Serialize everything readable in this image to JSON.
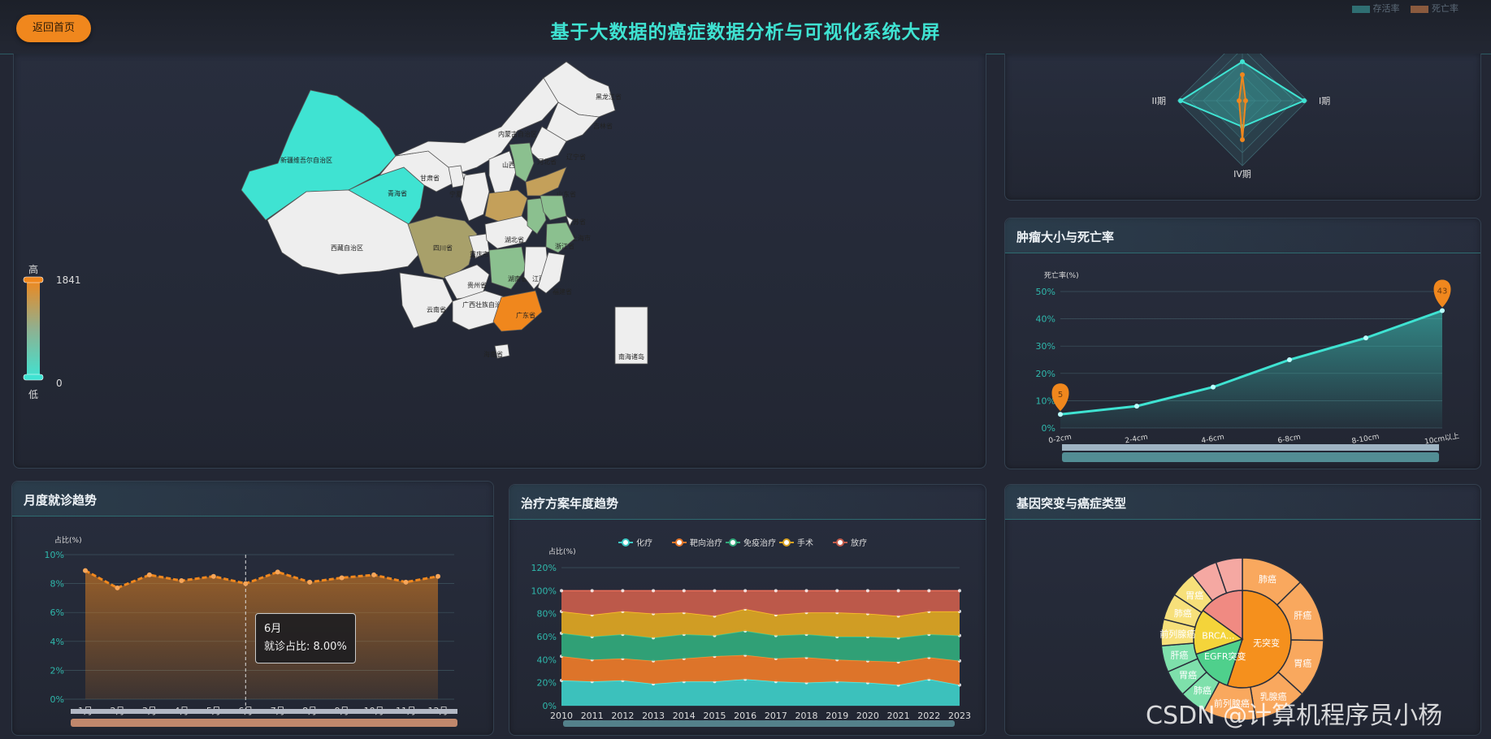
{
  "header": {
    "title": "基于大数据的癌症数据分析与可视化系统大屏",
    "back_label": "返回首页",
    "top_legend": [
      "存活率",
      "死亡率"
    ],
    "colors": {
      "accent": "#3fe3d2",
      "orange": "#f0871d"
    }
  },
  "map": {
    "visual_map": {
      "high_label": "高",
      "low_label": "低",
      "max": "1841",
      "min": "0"
    },
    "regions": [
      {
        "name": "新疆维吾尔自治区",
        "level": "high",
        "color": "#3fe3d2"
      },
      {
        "name": "青海省",
        "level": "high",
        "color": "#3fe3d2"
      },
      {
        "name": "西藏自治区",
        "level": "none",
        "color": "#eeeeee"
      },
      {
        "name": "甘肃省",
        "level": "none",
        "color": "#eeeeee"
      },
      {
        "name": "内蒙古自治区",
        "level": "none",
        "color": "#eeeeee"
      },
      {
        "name": "黑龙江省",
        "level": "none",
        "color": "#eeeeee"
      },
      {
        "name": "吉林省",
        "level": "none",
        "color": "#eeeeee"
      },
      {
        "name": "辽宁省",
        "level": "none",
        "color": "#eeeeee"
      },
      {
        "name": "宁夏回族自治区",
        "level": "none",
        "color": "#eeeeee"
      },
      {
        "name": "陕西省",
        "level": "none",
        "color": "#eeeeee"
      },
      {
        "name": "山西省",
        "level": "none",
        "color": "#eeeeee"
      },
      {
        "name": "河北省",
        "level": "mid",
        "color": "#8bc08f"
      },
      {
        "name": "山东省",
        "level": "mid",
        "color": "#c4a05a"
      },
      {
        "name": "河南省",
        "level": "mid",
        "color": "#c4a05a"
      },
      {
        "name": "四川省",
        "level": "mid",
        "color": "#a8a06a"
      },
      {
        "name": "重庆市",
        "level": "none",
        "color": "#eeeeee"
      },
      {
        "name": "湖北省",
        "level": "none",
        "color": "#eeeeee"
      },
      {
        "name": "安徽省",
        "level": "mid",
        "color": "#8bc08f"
      },
      {
        "name": "江苏省",
        "level": "mid",
        "color": "#8bc08f"
      },
      {
        "name": "上海市",
        "level": "none",
        "color": "#eeeeee"
      },
      {
        "name": "浙江省",
        "level": "mid",
        "color": "#8bc08f"
      },
      {
        "name": "湖南省",
        "level": "mid",
        "color": "#8bc08f"
      },
      {
        "name": "江西省",
        "level": "none",
        "color": "#eeeeee"
      },
      {
        "name": "福建省",
        "level": "none",
        "color": "#eeeeee"
      },
      {
        "name": "贵州省",
        "level": "none",
        "color": "#eeeeee"
      },
      {
        "name": "云南省",
        "level": "none",
        "color": "#eeeeee"
      },
      {
        "name": "广西壮族自治区",
        "level": "none",
        "color": "#eeeeee"
      },
      {
        "name": "广东省",
        "level": "max",
        "color": "#f0871d"
      },
      {
        "name": "海南省",
        "level": "none",
        "color": "#eeeeee"
      },
      {
        "name": "南海诸岛",
        "level": "none",
        "color": "#eeeeee"
      }
    ]
  },
  "radar": {
    "axes": [
      "III期",
      "I期",
      "IV期",
      "II期"
    ]
  },
  "tumor_panel": {
    "title": "肿瘤大小与死亡率"
  },
  "monthly_panel": {
    "title": "月度就诊趋势"
  },
  "treatment_panel": {
    "title": "治疗方案年度趋势"
  },
  "gene_panel": {
    "title": "基因突变与癌症类型"
  },
  "tooltip": {
    "title": "6月",
    "line": "就诊占比: 8.00%"
  },
  "watermark": "CSDN @计算机程序员小杨",
  "chart_data": [
    {
      "id": "tumor",
      "type": "line",
      "title": "肿瘤大小与死亡率",
      "ylabel": "死亡率(%)",
      "categories": [
        "0-2cm",
        "2-4cm",
        "4-6cm",
        "6-8cm",
        "8-10cm",
        "10cm以上"
      ],
      "values": [
        5,
        8,
        15,
        25,
        33,
        43
      ],
      "x_positions": [
        0,
        1,
        2,
        3,
        4,
        5
      ],
      "ylim": [
        0,
        50
      ],
      "yticks": [
        "0%",
        "10%",
        "20%",
        "30%",
        "40%",
        "50%"
      ],
      "markers": [
        {
          "label": "5",
          "index": 0
        },
        {
          "label": "43",
          "index": 5
        }
      ],
      "color": "#3fe3d2"
    },
    {
      "id": "monthly",
      "type": "area",
      "title": "月度就诊趋势",
      "ylabel": "占比(%)",
      "categories": [
        "1月",
        "2月",
        "3月",
        "4月",
        "5月",
        "6月",
        "7月",
        "8月",
        "9月",
        "10月",
        "11月",
        "12月"
      ],
      "values": [
        8.9,
        7.7,
        8.6,
        8.2,
        8.5,
        8.0,
        8.8,
        8.1,
        8.4,
        8.6,
        8.1,
        8.5
      ],
      "ylim": [
        0,
        10
      ],
      "yticks": [
        "0%",
        "2%",
        "4%",
        "6%",
        "8%",
        "10%"
      ],
      "highlight_index": 5,
      "color": "#f0871d"
    },
    {
      "id": "treatment",
      "type": "area",
      "title": "治疗方案年度趋势",
      "ylabel": "占比(%)",
      "categories": [
        "2010",
        "2011",
        "2012",
        "2013",
        "2014",
        "2015",
        "2016",
        "2017",
        "2018",
        "2019",
        "2020",
        "2021",
        "2022",
        "2023"
      ],
      "ylim": [
        0,
        120
      ],
      "yticks": [
        "0%",
        "20%",
        "40%",
        "60%",
        "80%",
        "100%",
        "120%"
      ],
      "legend": [
        "化疗",
        "靶向治疗",
        "免疫治疗",
        "手术",
        "放疗"
      ],
      "stacked": true,
      "series": [
        {
          "name": "化疗",
          "color": "#3ec9c4",
          "values": [
            22,
            21,
            22,
            19,
            21,
            21,
            23,
            21,
            20,
            21,
            20,
            18,
            23,
            18
          ]
        },
        {
          "name": "靶向治疗",
          "color": "#e8782a",
          "values": [
            21,
            19,
            19,
            20,
            20,
            22,
            21,
            20,
            22,
            19,
            19,
            20,
            19,
            21
          ]
        },
        {
          "name": "免疫治疗",
          "color": "#32a77a",
          "values": [
            20,
            20,
            21,
            20,
            21,
            18,
            21,
            20,
            20,
            20,
            21,
            21,
            20,
            22
          ]
        },
        {
          "name": "手术",
          "color": "#d9a323",
          "values": [
            19,
            19,
            20,
            21,
            19,
            17,
            19,
            18,
            19,
            21,
            20,
            19,
            20,
            21
          ]
        },
        {
          "name": "放疗",
          "color": "#c45c4b",
          "values": [
            18,
            21,
            18,
            20,
            19,
            22,
            16,
            21,
            19,
            19,
            20,
            22,
            18,
            18
          ]
        }
      ]
    },
    {
      "id": "radar",
      "type": "radar",
      "axes": [
        "III期",
        "I期",
        "IV期",
        "II期"
      ],
      "series": [
        {
          "name": "存活率",
          "color": "#3fe3d2",
          "values": [
            0.6,
            0.95,
            0.4,
            0.95
          ]
        },
        {
          "name": "死亡率",
          "color": "#f0871d",
          "values": [
            0.4,
            0.05,
            0.6,
            0.05
          ]
        }
      ]
    },
    {
      "id": "sunburst",
      "type": "pie",
      "title": "基因突变与癌症类型",
      "inner": [
        {
          "name": "无突变",
          "value": 55,
          "color": "#f5901d"
        },
        {
          "name": "EGFR突变",
          "value": 15,
          "color": "#4fd08c"
        },
        {
          "name": "BRCA...",
          "value": 15,
          "color": "#f4d43a"
        },
        {
          "name": "",
          "value": 15,
          "color": "#f08a82"
        }
      ],
      "outer": [
        {
          "name": "肺癌",
          "value": 12,
          "color": "#f9a85e"
        },
        {
          "name": "肝癌",
          "value": 12,
          "color": "#f9a85e"
        },
        {
          "name": "胃癌",
          "value": 11,
          "color": "#f9a85e"
        },
        {
          "name": "乳腺癌",
          "value": 10,
          "color": "#f9a85e"
        },
        {
          "name": "前列腺癌",
          "value": 10,
          "color": "#f9a85e"
        },
        {
          "name": "肺癌",
          "value": 5,
          "color": "#7ee0ab"
        },
        {
          "name": "胃癌",
          "value": 5,
          "color": "#7ee0ab"
        },
        {
          "name": "肝癌",
          "value": 5,
          "color": "#7ee0ab"
        },
        {
          "name": "前列腺癌",
          "value": 5,
          "color": "#f7e07a"
        },
        {
          "name": "肺癌",
          "value": 5,
          "color": "#f7e07a"
        },
        {
          "name": "胃癌",
          "value": 5,
          "color": "#f7e07a"
        },
        {
          "name": "",
          "value": 5,
          "color": "#f5a8a2"
        },
        {
          "name": "",
          "value": 5,
          "color": "#f5a8a2"
        }
      ]
    }
  ]
}
